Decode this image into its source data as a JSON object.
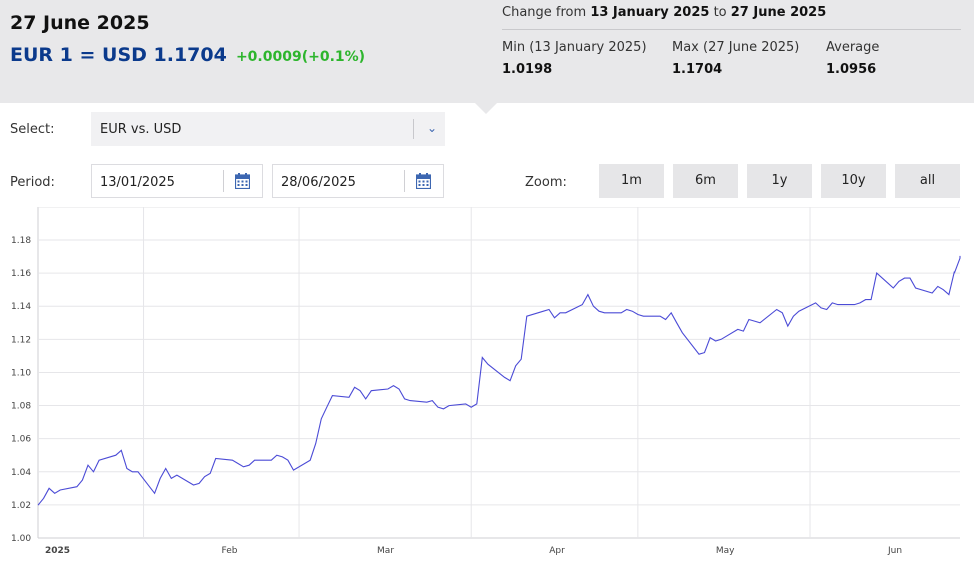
{
  "header": {
    "date_title": "27 June 2025",
    "rate_main": "EUR 1 = USD 1.1704",
    "rate_change": "+0.0009(+0.1%)",
    "range_prefix": "Change from",
    "range_from": "13 January 2025",
    "range_to_word": "to",
    "range_to": "27 June 2025",
    "min_label": "Min (13 January 2025)",
    "min_value": "1.0198",
    "max_label": "Max (27 June 2025)",
    "max_value": "1.1704",
    "avg_label": "Average",
    "avg_value": "1.0956"
  },
  "controls": {
    "select_label": "Select:",
    "select_value": "EUR vs. USD",
    "period_label": "Period:",
    "period_from": "13/01/2025",
    "period_to": "28/06/2025",
    "zoom_label": "Zoom:",
    "zoom_buttons": [
      "1m",
      "6m",
      "1y",
      "10y",
      "all"
    ]
  },
  "colors": {
    "line": "#4b4bd6",
    "rate": "#0b3a8c",
    "change_positive": "#2db52d",
    "panel": "#e8e8ea"
  },
  "chart_data": {
    "type": "line",
    "grid": true,
    "ylim": [
      1.0,
      1.18
    ],
    "yticks": [
      "1.00",
      "1.02",
      "1.04",
      "1.06",
      "1.08",
      "1.10",
      "1.12",
      "1.14",
      "1.16",
      "1.18"
    ],
    "xlim": [
      "2025-01-13",
      "2025-06-28"
    ],
    "month_labels": [
      {
        "date": "2025-01-13",
        "label": "2025"
      },
      {
        "date": "2025-02-01",
        "label": "Feb"
      },
      {
        "date": "2025-03-01",
        "label": "Mar"
      },
      {
        "date": "2025-04-01",
        "label": "Apr"
      },
      {
        "date": "2025-05-01",
        "label": "May"
      },
      {
        "date": "2025-06-01",
        "label": "Jun"
      }
    ],
    "series": [
      {
        "points": [
          [
            "2025-01-13",
            1.0198
          ],
          [
            "2025-01-14",
            1.024
          ],
          [
            "2025-01-15",
            1.03
          ],
          [
            "2025-01-16",
            1.027
          ],
          [
            "2025-01-17",
            1.029
          ],
          [
            "2025-01-20",
            1.031
          ],
          [
            "2025-01-21",
            1.035
          ],
          [
            "2025-01-22",
            1.044
          ],
          [
            "2025-01-23",
            1.04
          ],
          [
            "2025-01-24",
            1.047
          ],
          [
            "2025-01-27",
            1.05
          ],
          [
            "2025-01-28",
            1.053
          ],
          [
            "2025-01-29",
            1.042
          ],
          [
            "2025-01-30",
            1.04
          ],
          [
            "2025-01-31",
            1.04
          ],
          [
            "2025-02-03",
            1.027
          ],
          [
            "2025-02-04",
            1.036
          ],
          [
            "2025-02-05",
            1.042
          ],
          [
            "2025-02-06",
            1.036
          ],
          [
            "2025-02-07",
            1.038
          ],
          [
            "2025-02-10",
            1.032
          ],
          [
            "2025-02-11",
            1.033
          ],
          [
            "2025-02-12",
            1.037
          ],
          [
            "2025-02-13",
            1.039
          ],
          [
            "2025-02-14",
            1.048
          ],
          [
            "2025-02-17",
            1.047
          ],
          [
            "2025-02-18",
            1.045
          ],
          [
            "2025-02-19",
            1.043
          ],
          [
            "2025-02-20",
            1.044
          ],
          [
            "2025-02-21",
            1.047
          ],
          [
            "2025-02-24",
            1.047
          ],
          [
            "2025-02-25",
            1.05
          ],
          [
            "2025-02-26",
            1.049
          ],
          [
            "2025-02-27",
            1.047
          ],
          [
            "2025-02-28",
            1.041
          ],
          [
            "2025-03-03",
            1.047
          ],
          [
            "2025-03-04",
            1.057
          ],
          [
            "2025-03-05",
            1.072
          ],
          [
            "2025-03-06",
            1.079
          ],
          [
            "2025-03-07",
            1.086
          ],
          [
            "2025-03-10",
            1.085
          ],
          [
            "2025-03-11",
            1.091
          ],
          [
            "2025-03-12",
            1.089
          ],
          [
            "2025-03-13",
            1.084
          ],
          [
            "2025-03-14",
            1.089
          ],
          [
            "2025-03-17",
            1.09
          ],
          [
            "2025-03-18",
            1.092
          ],
          [
            "2025-03-19",
            1.09
          ],
          [
            "2025-03-20",
            1.084
          ],
          [
            "2025-03-21",
            1.083
          ],
          [
            "2025-03-24",
            1.082
          ],
          [
            "2025-03-25",
            1.083
          ],
          [
            "2025-03-26",
            1.079
          ],
          [
            "2025-03-27",
            1.078
          ],
          [
            "2025-03-28",
            1.08
          ],
          [
            "2025-03-31",
            1.081
          ],
          [
            "2025-04-01",
            1.079
          ],
          [
            "2025-04-02",
            1.081
          ],
          [
            "2025-04-03",
            1.109
          ],
          [
            "2025-04-04",
            1.105
          ],
          [
            "2025-04-07",
            1.097
          ],
          [
            "2025-04-08",
            1.095
          ],
          [
            "2025-04-09",
            1.104
          ],
          [
            "2025-04-10",
            1.108
          ],
          [
            "2025-04-11",
            1.134
          ],
          [
            "2025-04-14",
            1.137
          ],
          [
            "2025-04-15",
            1.138
          ],
          [
            "2025-04-16",
            1.133
          ],
          [
            "2025-04-17",
            1.136
          ],
          [
            "2025-04-18",
            1.136
          ],
          [
            "2025-04-21",
            1.141
          ],
          [
            "2025-04-22",
            1.147
          ],
          [
            "2025-04-23",
            1.14
          ],
          [
            "2025-04-24",
            1.137
          ],
          [
            "2025-04-25",
            1.136
          ],
          [
            "2025-04-28",
            1.136
          ],
          [
            "2025-04-29",
            1.138
          ],
          [
            "2025-04-30",
            1.137
          ],
          [
            "2025-05-01",
            1.135
          ],
          [
            "2025-05-02",
            1.134
          ],
          [
            "2025-05-05",
            1.134
          ],
          [
            "2025-05-06",
            1.132
          ],
          [
            "2025-05-07",
            1.136
          ],
          [
            "2025-05-08",
            1.13
          ],
          [
            "2025-05-09",
            1.124
          ],
          [
            "2025-05-12",
            1.111
          ],
          [
            "2025-05-13",
            1.112
          ],
          [
            "2025-05-14",
            1.121
          ],
          [
            "2025-05-15",
            1.119
          ],
          [
            "2025-05-16",
            1.12
          ],
          [
            "2025-05-19",
            1.126
          ],
          [
            "2025-05-20",
            1.125
          ],
          [
            "2025-05-21",
            1.132
          ],
          [
            "2025-05-22",
            1.131
          ],
          [
            "2025-05-23",
            1.13
          ],
          [
            "2025-05-26",
            1.138
          ],
          [
            "2025-05-27",
            1.136
          ],
          [
            "2025-05-28",
            1.128
          ],
          [
            "2025-05-29",
            1.134
          ],
          [
            "2025-05-30",
            1.137
          ],
          [
            "2025-06-02",
            1.142
          ],
          [
            "2025-06-03",
            1.139
          ],
          [
            "2025-06-04",
            1.138
          ],
          [
            "2025-06-05",
            1.142
          ],
          [
            "2025-06-06",
            1.141
          ],
          [
            "2025-06-09",
            1.141
          ],
          [
            "2025-06-10",
            1.142
          ],
          [
            "2025-06-11",
            1.144
          ],
          [
            "2025-06-12",
            1.144
          ],
          [
            "2025-06-13",
            1.16
          ],
          [
            "2025-06-16",
            1.151
          ],
          [
            "2025-06-17",
            1.155
          ],
          [
            "2025-06-18",
            1.157
          ],
          [
            "2025-06-19",
            1.157
          ],
          [
            "2025-06-20",
            1.151
          ],
          [
            "2025-06-23",
            1.148
          ],
          [
            "2025-06-24",
            1.152
          ],
          [
            "2025-06-25",
            1.15
          ],
          [
            "2025-06-26",
            1.147
          ],
          [
            "2025-06-27",
            1.161
          ],
          [
            "2025-06-27",
            1.16
          ],
          [
            "2025-06-28",
            1.169
          ],
          [
            "2025-06-28",
            1.1704
          ]
        ]
      }
    ]
  }
}
